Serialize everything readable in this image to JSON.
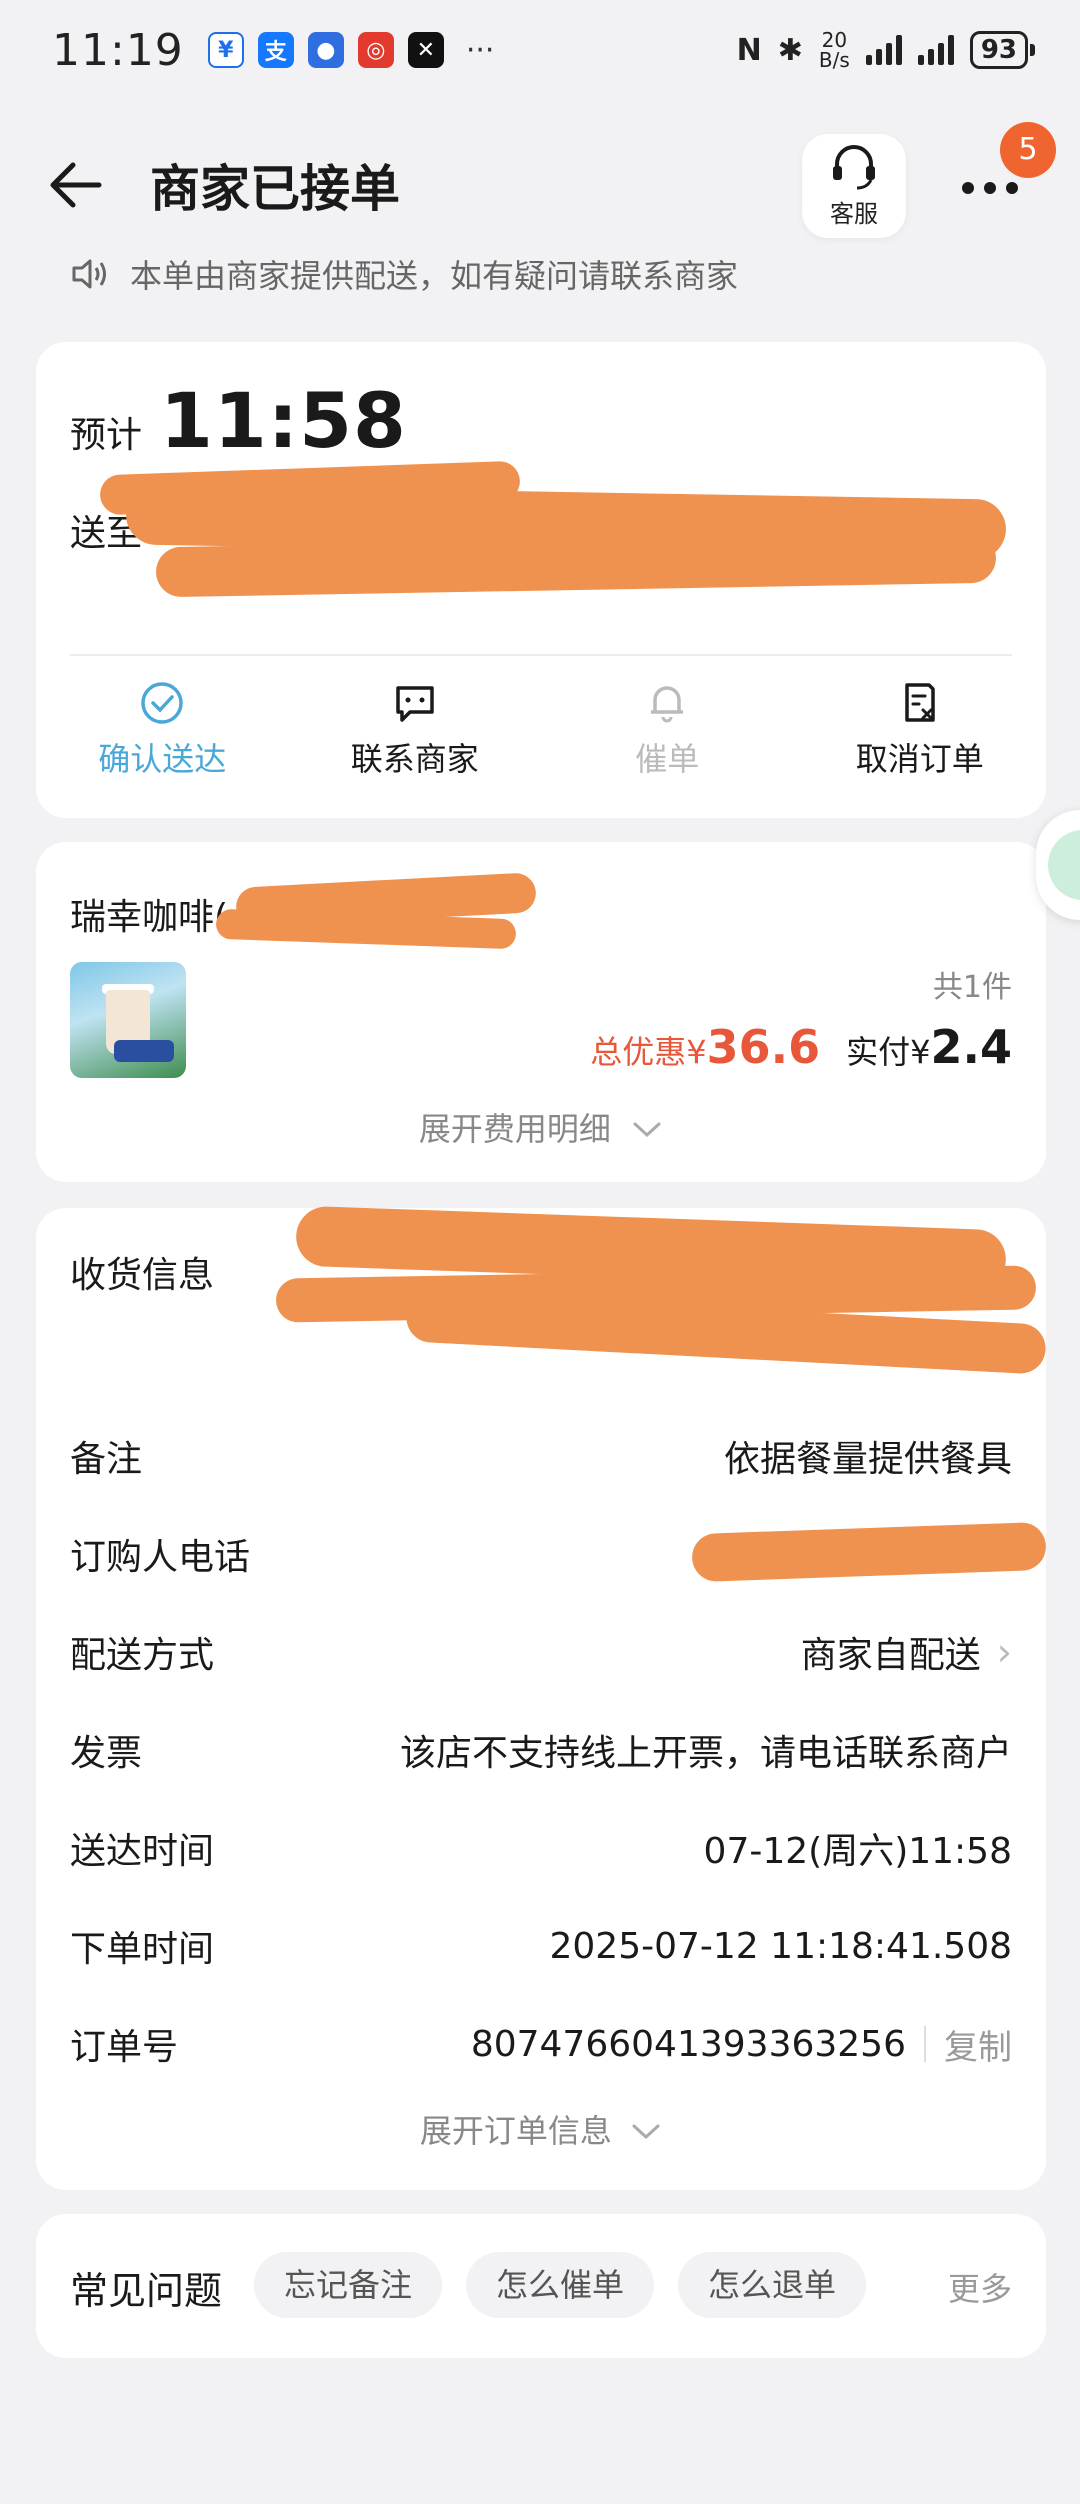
{
  "status_bar": {
    "time": "11:19",
    "speed_top": "20",
    "speed_bottom": "B/s",
    "battery": "93",
    "dots": "···"
  },
  "nav": {
    "title": "商家已接单",
    "service_label": "客服",
    "badge_count": "5"
  },
  "notice": "本单由商家提供配送，如有疑问请联系商家",
  "delivery": {
    "eta_label": "预计",
    "eta_time": "11:58",
    "address_label": "送至",
    "actions": [
      {
        "label": "确认送达",
        "icon": "check-circle-icon",
        "color": "#4aa8d8"
      },
      {
        "label": "联系商家",
        "icon": "chat-icon",
        "color": "#1a1a1a"
      },
      {
        "label": "催单",
        "icon": "bell-icon",
        "color": "#bbbbbb"
      },
      {
        "label": "取消订单",
        "icon": "cancel-order-icon",
        "color": "#1a1a1a"
      }
    ]
  },
  "store": {
    "name": "瑞幸咖啡(",
    "item_count": "共1件",
    "discount_label": "总优惠¥",
    "discount_value": "36.6",
    "paid_label": "实付¥",
    "paid_value": "2.4",
    "expand_fee": "展开费用明细"
  },
  "info": {
    "receiver_label": "收货信息",
    "note_label": "备注",
    "note_value": "依据餐量提供餐具",
    "phone_label": "订购人电话",
    "delivery_method_label": "配送方式",
    "delivery_method_value": "商家自配送",
    "invoice_label": "发票",
    "invoice_value": "该店不支持线上开票，请电话联系商户",
    "arrive_label": "送达时间",
    "arrive_value": "07-12(周六)11:58",
    "order_time_label": "下单时间",
    "order_time_value": "2025-07-12 11:18:41.508",
    "order_no_label": "订单号",
    "order_no_value": "8074766041393363256",
    "copy_label": "复制",
    "expand_order": "展开订单信息"
  },
  "faq": {
    "title": "常见问题",
    "chips": [
      "忘记备注",
      "怎么催单",
      "怎么退单"
    ],
    "more": "更多"
  },
  "colors": {
    "accent_blue": "#4aa8d8",
    "discount_red": "#e8573a",
    "badge_orange": "#f0642f",
    "redaction": "#f0924f"
  }
}
